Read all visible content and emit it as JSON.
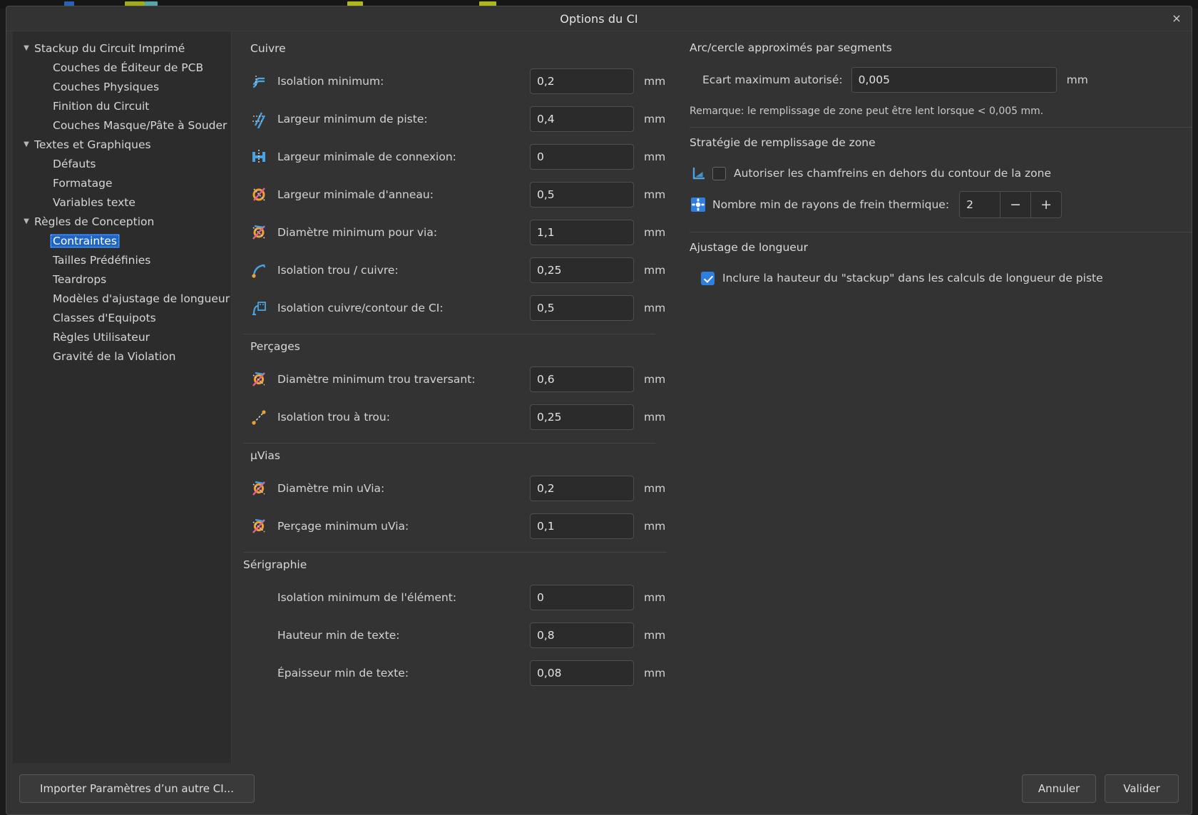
{
  "window": {
    "title": "Options du CI",
    "close_label": "×"
  },
  "sidebar": {
    "items": [
      {
        "label": "Stackup du Circuit Imprimé",
        "level": 0,
        "expanded": true,
        "selected": false
      },
      {
        "label": "Couches de Éditeur de PCB",
        "level": 1,
        "expanded": false,
        "selected": false
      },
      {
        "label": "Couches Physiques",
        "level": 1,
        "expanded": false,
        "selected": false
      },
      {
        "label": "Finition du Circuit",
        "level": 1,
        "expanded": false,
        "selected": false
      },
      {
        "label": "Couches Masque/Pâte à Souder",
        "level": 1,
        "expanded": false,
        "selected": false
      },
      {
        "label": "Textes et Graphiques",
        "level": 0,
        "expanded": true,
        "selected": false
      },
      {
        "label": "Défauts",
        "level": 1,
        "expanded": false,
        "selected": false
      },
      {
        "label": "Formatage",
        "level": 1,
        "expanded": false,
        "selected": false
      },
      {
        "label": "Variables texte",
        "level": 1,
        "expanded": false,
        "selected": false
      },
      {
        "label": "Règles de Conception",
        "level": 0,
        "expanded": true,
        "selected": false
      },
      {
        "label": "Contraintes",
        "level": 1,
        "expanded": false,
        "selected": true
      },
      {
        "label": "Tailles Prédéfinies",
        "level": 1,
        "expanded": false,
        "selected": false
      },
      {
        "label": "Teardrops",
        "level": 1,
        "expanded": false,
        "selected": false
      },
      {
        "label": "Modèles d'ajustage de longueur",
        "level": 1,
        "expanded": false,
        "selected": false
      },
      {
        "label": "Classes d'Equipots",
        "level": 1,
        "expanded": false,
        "selected": false
      },
      {
        "label": "Règles Utilisateur",
        "level": 1,
        "expanded": false,
        "selected": false
      },
      {
        "label": "Gravité de la Violation",
        "level": 1,
        "expanded": false,
        "selected": false
      }
    ]
  },
  "left_column": {
    "copper": {
      "title": "Cuivre",
      "rows": [
        {
          "icon": "min-clearance-icon",
          "label": "Isolation minimum:",
          "value": "0,2",
          "unit": "mm"
        },
        {
          "icon": "min-track-width-icon",
          "label": "Largeur minimum de piste:",
          "value": "0,4",
          "unit": "mm"
        },
        {
          "icon": "min-connection-width-icon",
          "label": "Largeur minimale de connexion:",
          "value": "0",
          "unit": "mm"
        },
        {
          "icon": "min-annular-ring-icon",
          "label": "Largeur minimale d'anneau:",
          "value": "0,5",
          "unit": "mm"
        },
        {
          "icon": "min-via-diameter-icon",
          "label": "Diamètre minimum pour via:",
          "value": "1,1",
          "unit": "mm"
        },
        {
          "icon": "hole-to-copper-clearance-icon",
          "label": "Isolation trou / cuivre:",
          "value": "0,25",
          "unit": "mm"
        },
        {
          "icon": "copper-edge-clearance-icon",
          "label": "Isolation cuivre/contour de CI:",
          "value": "0,5",
          "unit": "mm"
        }
      ]
    },
    "holes": {
      "title": "Perçages",
      "rows": [
        {
          "icon": "min-through-hole-icon",
          "label": "Diamètre minimum trou traversant:",
          "value": "0,6",
          "unit": "mm"
        },
        {
          "icon": "hole-to-hole-clearance-icon",
          "label": "Isolation trou à trou:",
          "value": "0,25",
          "unit": "mm"
        }
      ]
    },
    "uvias": {
      "title": "µVias",
      "rows": [
        {
          "icon": "min-uvia-diameter-icon",
          "label": "Diamètre min uVia:",
          "value": "0,2",
          "unit": "mm"
        },
        {
          "icon": "min-uvia-drill-icon",
          "label": "Perçage minimum uVia:",
          "value": "0,1",
          "unit": "mm"
        }
      ]
    },
    "silkscreen": {
      "title": "Sérigraphie",
      "rows": [
        {
          "icon": "",
          "label": "Isolation minimum de l'élément:",
          "value": "0",
          "unit": "mm"
        },
        {
          "icon": "",
          "label": "Hauteur min de texte:",
          "value": "0,8",
          "unit": "mm"
        },
        {
          "icon": "",
          "label": "Épaisseur min de texte:",
          "value": "0,08",
          "unit": "mm"
        }
      ]
    }
  },
  "right_column": {
    "arc_segments": {
      "title": "Arc/cercle approximés par segments",
      "max_error_label": "Ecart maximum autorisé:",
      "max_error_value": "0,005",
      "max_error_unit": "mm",
      "note": "Remarque: le remplissage de zone peut être lent lorsque < 0,005 mm."
    },
    "zone_fill": {
      "title": "Stratégie de remplissage de zone",
      "chamfer_label": "Autoriser les chamfreins en dehors du contour de la zone",
      "chamfer_checked": false,
      "chamfer_icon": "chamfer-icon",
      "spokes_label": "Nombre min de rayons de frein thermique:",
      "spokes_value": "2",
      "spokes_icon": "thermal-spokes-icon",
      "spin_minus": "−",
      "spin_plus": "+"
    },
    "length_tuning": {
      "title": "Ajustage de longueur",
      "stackup_label": "Inclure la hauteur du \"stackup\" dans les calculs de longueur de piste",
      "stackup_checked": true
    }
  },
  "footer": {
    "import_label": "Importer Paramètres d’un autre CI...",
    "cancel_label": "Annuler",
    "ok_label": "Valider"
  },
  "colors": {
    "dialog_bg": "#333333",
    "sidebar_bg": "#2c2c2c",
    "input_bg": "#2b2b2b",
    "accent_selection": "#1f64c8",
    "accent_checkbox": "#2f7fe0",
    "icon_blue": "#4aa3e0",
    "icon_orange": "#f0a030",
    "icon_pink": "#e8618c",
    "text": "#d3d3d3"
  }
}
